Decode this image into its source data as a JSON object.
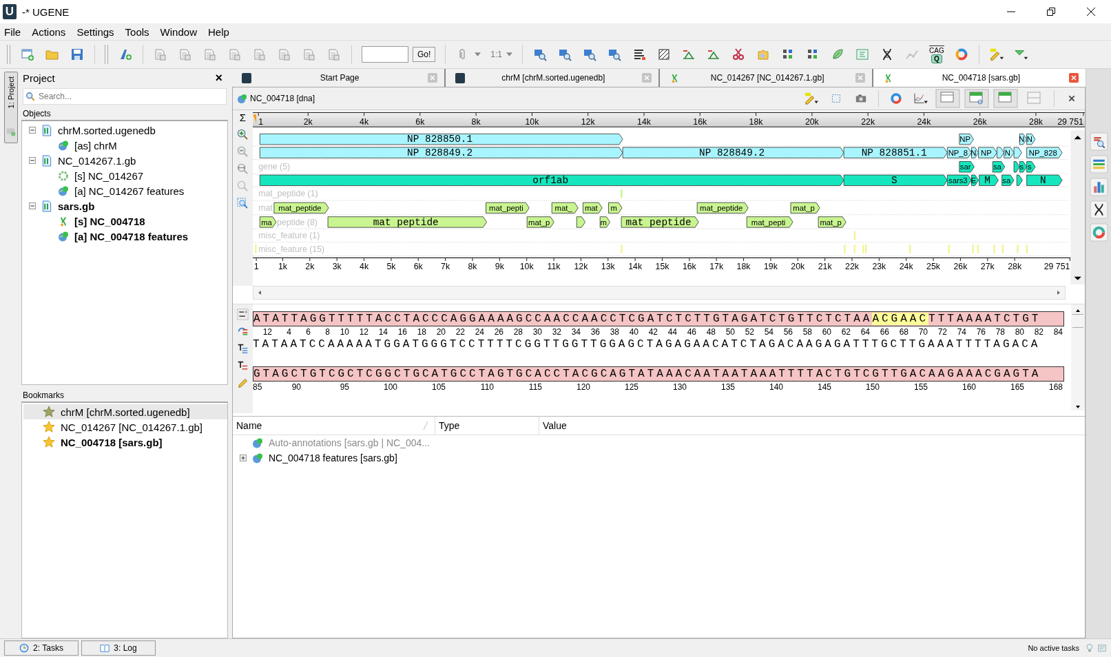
{
  "window": {
    "app_letter": "U",
    "title": "-* UGENE"
  },
  "menu": [
    "File",
    "Actions",
    "Settings",
    "Tools",
    "Window",
    "Help"
  ],
  "toolbar": {
    "go_button": "Go!",
    "zoom_ratio": "1:1",
    "cag_label": "CAG",
    "q_label": "Q"
  },
  "side_tab": "1: Project",
  "project": {
    "title": "Project",
    "close": "×",
    "search_placeholder": "Search...",
    "objects_label": "Objects",
    "tree": [
      {
        "label": "chrM.sorted.ugenedb",
        "kind": "document",
        "active": false,
        "expanded": true,
        "children": [
          {
            "label": "[as] chrM",
            "kind": "annotations",
            "active": false
          }
        ]
      },
      {
        "label": "NC_014267.1.gb",
        "kind": "document",
        "active": false,
        "expanded": true,
        "children": [
          {
            "label": "[s] NC_014267",
            "kind": "circular",
            "active": false
          },
          {
            "label": "[a] NC_014267 features",
            "kind": "annotations",
            "active": false
          }
        ]
      },
      {
        "label": "sars.gb",
        "kind": "document",
        "active": true,
        "expanded": true,
        "children": [
          {
            "label": "[s] NC_004718",
            "kind": "sequence",
            "active": true
          },
          {
            "label": "[a] NC_004718 features",
            "kind": "annotations",
            "active": true
          }
        ]
      }
    ],
    "bookmarks_label": "Bookmarks",
    "bookmarks": [
      {
        "label": "chrM [chrM.sorted.ugenedb]",
        "selected": true,
        "loaded": false,
        "active": false
      },
      {
        "label": "NC_014267 [NC_014267.1.gb]",
        "selected": false,
        "loaded": true,
        "active": false
      },
      {
        "label": "NC_004718 [sars.gb]",
        "selected": false,
        "loaded": true,
        "active": true
      }
    ]
  },
  "tabs": [
    {
      "label": "Start Page",
      "kind": "start",
      "selected": false
    },
    {
      "label": "chrM [chrM.sorted.ugenedb]",
      "kind": "start",
      "selected": false
    },
    {
      "label": "NC_014267 [NC_014267.1.gb]",
      "kind": "sequence",
      "selected": false
    },
    {
      "label": "NC_004718 [sars.gb]",
      "kind": "sequence",
      "selected": true
    }
  ],
  "view": {
    "title": "NC_004718 [dna]",
    "sigma": "Σ",
    "top_ruler": [
      "1",
      "2k",
      "4k",
      "6k",
      "8k",
      "10k",
      "12k",
      "14k",
      "16k",
      "18k",
      "20k",
      "22k",
      "24k",
      "26k",
      "28k",
      "29 751"
    ],
    "tracks": [
      {
        "kind": "cds",
        "features": [
          "NP 828850.1",
          "NP",
          "N",
          "N"
        ]
      },
      {
        "kind": "cds",
        "features": [
          "NP 828849.2",
          "NP 828849.2",
          "NP 828851.1",
          "NP_8",
          "N",
          "NP",
          "N",
          "NP_828"
        ]
      },
      {
        "kind": "gene",
        "label": "gene (5)",
        "features": [
          "sar",
          "sa",
          "s",
          "s"
        ]
      },
      {
        "kind": "gene",
        "features": [
          "orf1ab",
          "S",
          "sars3",
          "E",
          "M",
          "sa",
          "N"
        ]
      },
      {
        "kind": "mat_peptide",
        "label": "mat_peptide (1)"
      },
      {
        "kind": "mat_peptide",
        "label": "mat",
        "features": [
          "mat_peptide",
          "mat_pepti",
          "mat_",
          "mat",
          "m",
          "mat_peptide",
          "mat_p"
        ]
      },
      {
        "kind": "mat_peptide",
        "label": "peptide (8)",
        "features": [
          "ma",
          "mat peptide",
          "mat_p",
          "m",
          "mat peptide",
          "mat_pepti",
          "mat_p"
        ]
      },
      {
        "kind": "misc_feature",
        "label": "misc_feature (1)"
      },
      {
        "kind": "misc_feature",
        "label": "misc_feature (15)"
      }
    ],
    "bottom_ruler": [
      "1",
      "1k",
      "2k",
      "3k",
      "4k",
      "5k",
      "6k",
      "7k",
      "8k",
      "9k",
      "10k",
      "11k",
      "12k",
      "13k",
      "14k",
      "15k",
      "16k",
      "17k",
      "18k",
      "19k",
      "20k",
      "21k",
      "22k",
      "23k",
      "24k",
      "25k",
      "26k",
      "27k",
      "28k",
      "29 751"
    ]
  },
  "sequence_view": {
    "lines": [
      {
        "strand": [
          {
            "text": "ATATTAGGTTTTTACCTACCCAGGAAAAGCCAACCAACCTCGATCTCTTGTAGATCTGTTCTCTAA",
            "selected": false
          },
          {
            "text": "ACGAAC",
            "selected": true
          },
          {
            "text": "TTTAAAATCTGT",
            "selected": false
          }
        ],
        "ruler": [
          "12",
          "4",
          "6",
          "8",
          "10",
          "12",
          "14",
          "16",
          "18",
          "20",
          "22",
          "24",
          "26",
          "28",
          "30",
          "32",
          "34",
          "36",
          "38",
          "40",
          "42",
          "44",
          "46",
          "48",
          "50",
          "52",
          "54",
          "56",
          "58",
          "60",
          "62",
          "64",
          "66",
          "68",
          "70",
          "72",
          "74",
          "76",
          "78",
          "80",
          "82",
          "84"
        ],
        "complement": "TATAATCCAAAAATGGATGGGTCCTTTTCGGTTGGTTGGAGCTAGAGAACATCTAGACAAGAGATTTGCTTGAAATTTTAGACA"
      },
      {
        "strand": [
          {
            "text": "GTAGCTGTCGCTCGGCTGCATGCCTAGTGCACCTACGCAGTATAAACAATAATAAATTTTACTGTCGTTGACAAGAAACGAGTA",
            "selected": false
          }
        ],
        "ruler": [
          "85",
          "90",
          "95",
          "100",
          "105",
          "110",
          "115",
          "120",
          "125",
          "130",
          "135",
          "140",
          "145",
          "150",
          "155",
          "160",
          "165",
          "168"
        ]
      }
    ]
  },
  "table": {
    "columns": [
      "Name",
      "Type",
      "Value"
    ],
    "rows": [
      {
        "label": "Auto-annotations [sars.gb | NC_004...",
        "disabled": true,
        "expandable": false
      },
      {
        "label": "NC_004718 features [sars.gb]",
        "disabled": false,
        "expandable": true
      }
    ]
  },
  "status": {
    "tasks_button": "2: Tasks",
    "log_button": "3: Log",
    "message": "No active tasks"
  }
}
